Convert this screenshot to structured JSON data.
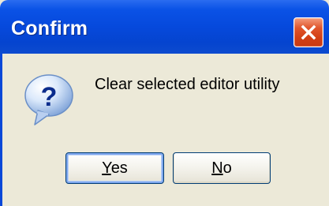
{
  "window": {
    "title": "Confirm",
    "close_label": "Close"
  },
  "dialog": {
    "icon": "question-icon",
    "message": "Clear selected editor utility"
  },
  "buttons": {
    "yes": {
      "mnemonic": "Y",
      "rest": "es"
    },
    "no": {
      "mnemonic": "N",
      "rest": "o"
    }
  },
  "colors": {
    "titlebar": "#0649dc",
    "close_button": "#d23f15",
    "dialog_background": "#ECE9D8",
    "default_button_focus": "#7fa8ee"
  }
}
